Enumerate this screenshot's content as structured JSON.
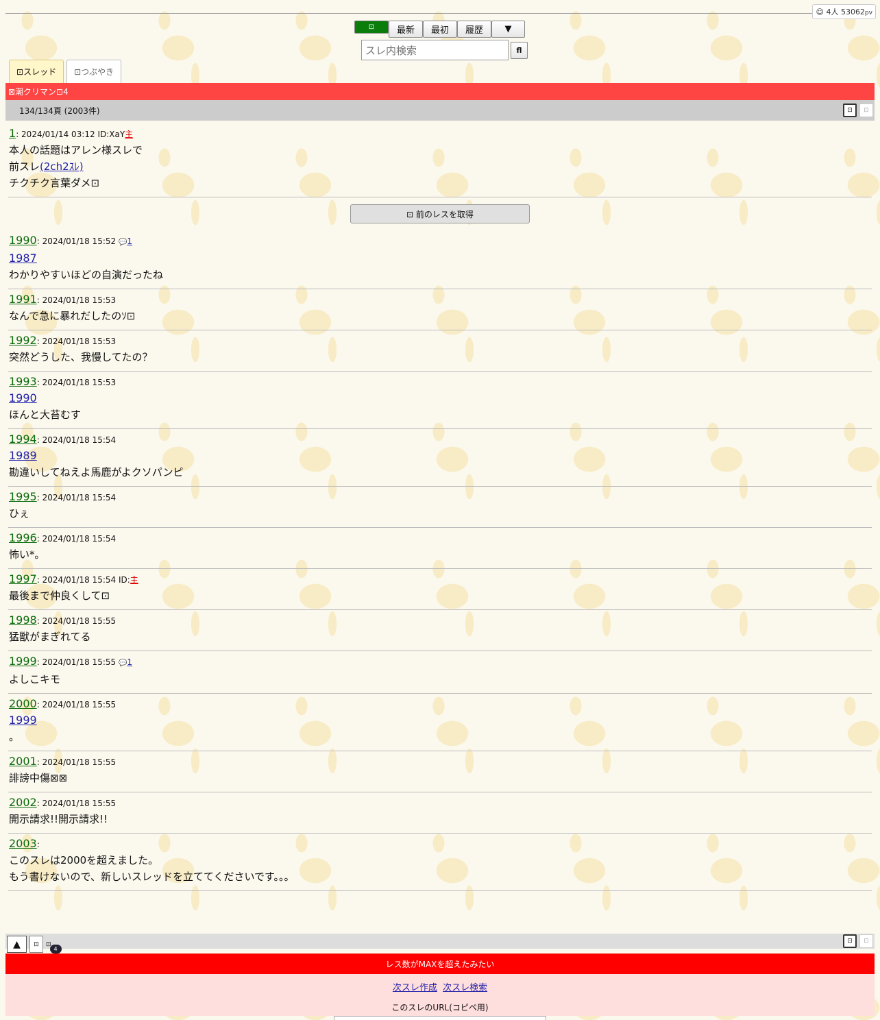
{
  "counter": {
    "people": "4人",
    "views": "53062",
    "unit": "pv"
  },
  "nav": {
    "home_icon": "home-icon",
    "latest": "最新",
    "first": "最初",
    "history": "履歴",
    "menu": "▼"
  },
  "search": {
    "placeholder": "スレ内検索",
    "button": "fl"
  },
  "tabs": [
    {
      "label": "スレッド"
    },
    {
      "label": "つぶやき"
    }
  ],
  "thread": {
    "title": "⊠潮クリマン⊡4",
    "pages": "134/134頁 (2003件)"
  },
  "first_post": {
    "num": "1",
    "date": "2024/01/14 03:12",
    "id_prefix": "ID:XaY",
    "host": "主",
    "lines": [
      "本人の話題はアレン様スレで",
      "前スレ",
      "チクチク言葉ダメ⊡"
    ],
    "link": "(2ch2ｽﾚ)"
  },
  "more_button": "⊡ 前のレスを取得",
  "posts": [
    {
      "num": "1990",
      "date": "2024/01/18 15:52",
      "replies": "1",
      "anchor": "1987",
      "text": "わかりやすいほどの自演だったね"
    },
    {
      "num": "1991",
      "date": "2024/01/18 15:53",
      "text": "なんで急に暴れだしたのｿ⊡"
    },
    {
      "num": "1992",
      "date": "2024/01/18 15:53",
      "text": "突然どうした、我慢してたの？"
    },
    {
      "num": "1993",
      "date": "2024/01/18 15:53",
      "anchor": "1990",
      "text": "ほんと大苔むす"
    },
    {
      "num": "1994",
      "date": "2024/01/18 15:54",
      "anchor": "1989",
      "text": "勘違いしてねえよ馬鹿がよクソパンピ"
    },
    {
      "num": "1995",
      "date": "2024/01/18 15:54",
      "text": "ひぇ"
    },
    {
      "num": "1996",
      "date": "2024/01/18 15:54",
      "text": "怖い*｡"
    },
    {
      "num": "1997",
      "date": "2024/01/18 15:54",
      "id": "ID:",
      "host": "主",
      "text": "最後まで仲良くして⊡"
    },
    {
      "num": "1998",
      "date": "2024/01/18 15:55",
      "text": "猛獣がまぎれてる"
    },
    {
      "num": "1999",
      "date": "2024/01/18 15:55",
      "replies": "1",
      "text": "よしこキモ"
    },
    {
      "num": "2000",
      "date": "2024/01/18 15:55",
      "anchor": "1999",
      "text": "。"
    },
    {
      "num": "2001",
      "date": "2024/01/18 15:55",
      "text": "誹謗中傷⊠⊠"
    },
    {
      "num": "2002",
      "date": "2024/01/18 15:55",
      "text": "開示請求!!開示請求!!"
    }
  ],
  "final_post": {
    "num": "2003",
    "lines": [
      "このスレは2000を超えました。",
      "もう書けないので、新しいスレッドを立ててくださいです。。。"
    ]
  },
  "footer": {
    "up": "▲",
    "badge": "4"
  },
  "max_notice": "レス数がMAXを超えたみたい",
  "next": {
    "create": "次スレ作成",
    "search": "次スレ検索",
    "url_label": "このスレのURL(コピペ用)"
  }
}
